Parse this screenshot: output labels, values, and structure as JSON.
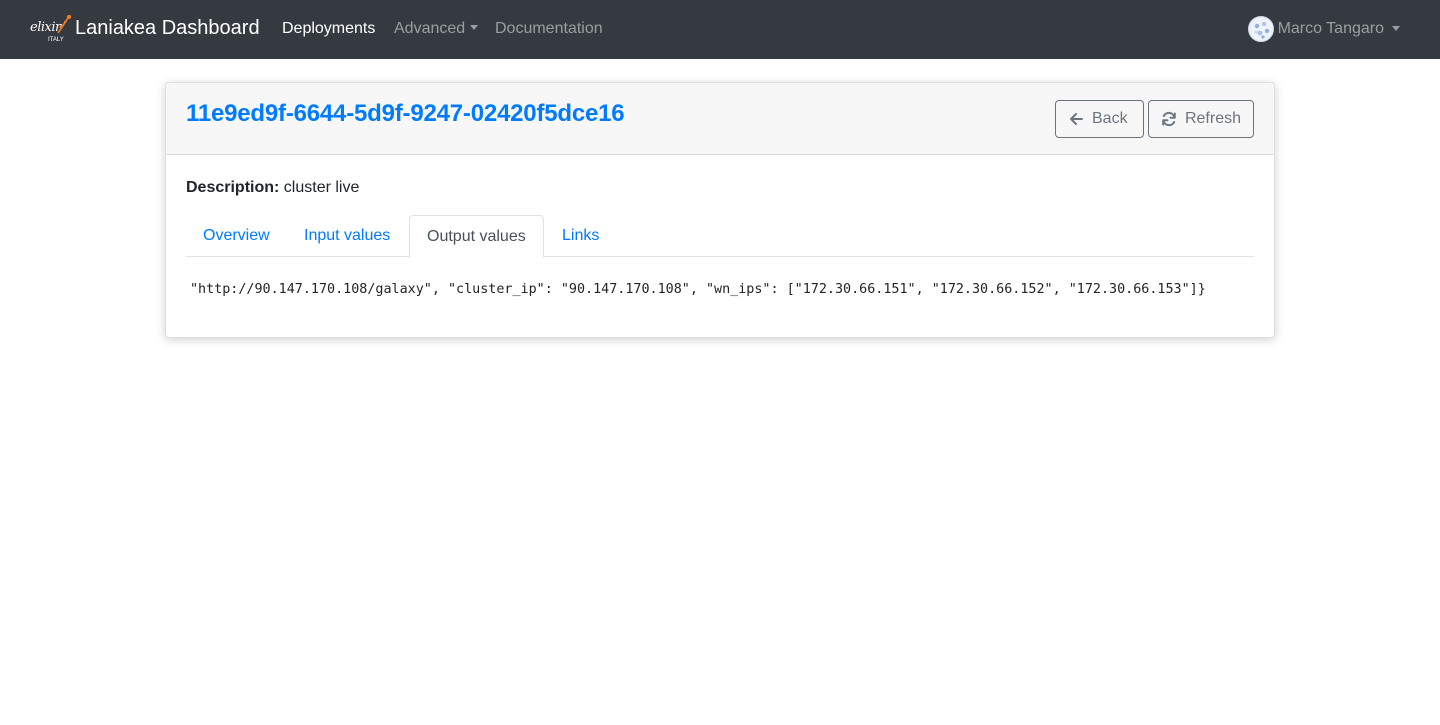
{
  "navbar": {
    "logo_text": "elixir",
    "logo_sub": "ITALY",
    "brand": "Laniakea Dashboard",
    "items": [
      {
        "label": "Deployments",
        "active": true
      },
      {
        "label": "Advanced",
        "dropdown": true
      },
      {
        "label": "Documentation"
      }
    ],
    "user": {
      "name": "Marco Tangaro"
    }
  },
  "deployment": {
    "id": "11e9ed9f-6644-5d9f-9247-02420f5dce16",
    "description_label": "Description:",
    "description": "cluster live"
  },
  "toolbar": {
    "back_label": "Back",
    "refresh_label": "Refresh"
  },
  "tabs": [
    {
      "label": "Overview"
    },
    {
      "label": "Input values"
    },
    {
      "label": "Output values",
      "active": true
    },
    {
      "label": "Links"
    }
  ],
  "output": {
    "text": "\"http://90.147.170.108/galaxy\", \"cluster_ip\": \"90.147.170.108\", \"wn_ips\": [\"172.30.66.151\", \"172.30.66.152\", \"172.30.66.153\"]}"
  },
  "colors": {
    "navbar_bg": "#343a40",
    "link": "#007bff",
    "muted": "#6c757d",
    "logo_accent": "#f47d20"
  }
}
